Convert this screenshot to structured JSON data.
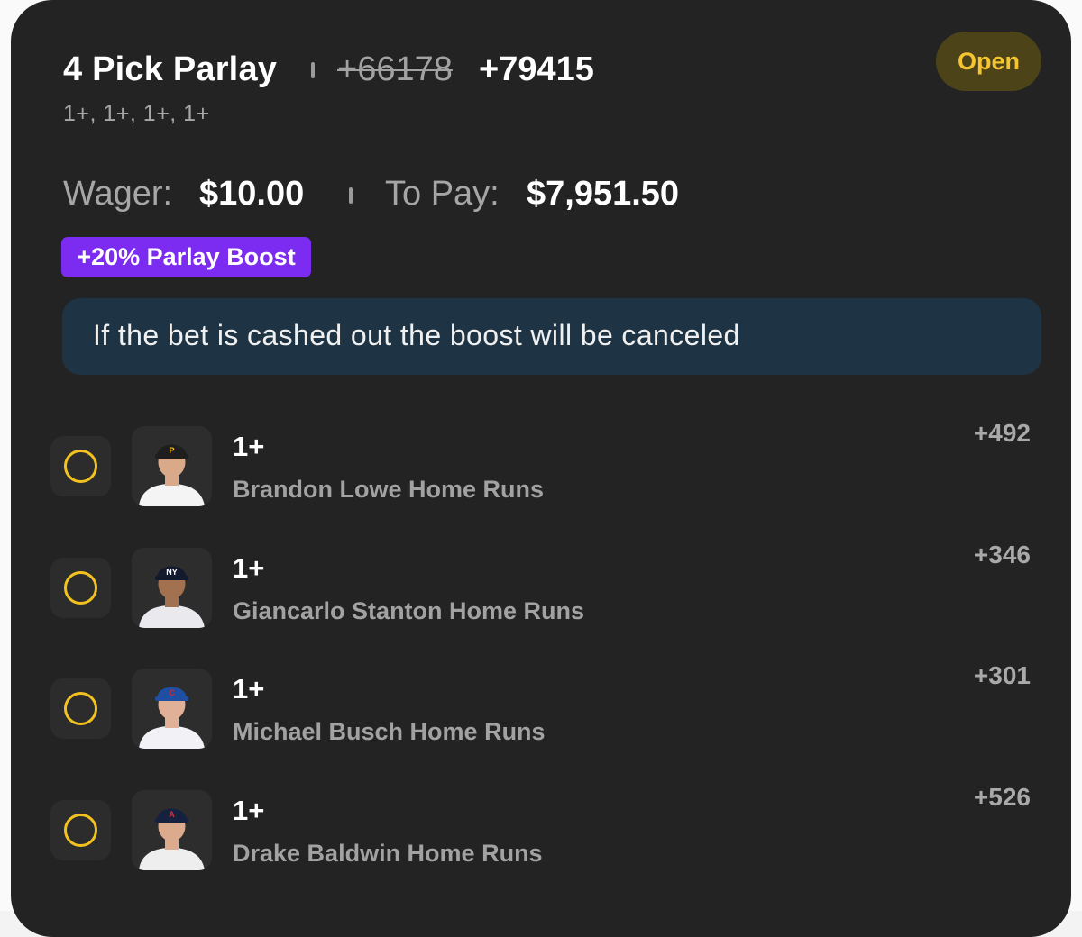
{
  "bet": {
    "title": "4 Pick Parlay",
    "original_odds": "+66178",
    "boosted_odds": "+79415",
    "lines_summary": "1+, 1+, 1+, 1+",
    "status": "Open",
    "wager_label": "Wager:",
    "wager_value": "$10.00",
    "to_pay_label": "To Pay:",
    "to_pay_value": "$7,951.50",
    "boost_label": "+20% Parlay Boost",
    "notice": "If the bet is cashed out the boost will be canceled"
  },
  "picks": [
    {
      "line": "1+",
      "market": "Brandon Lowe Home Runs",
      "odds": "+492",
      "team": "Pirates",
      "cap_color": "#1e1e1e",
      "cap_logo": "P",
      "logo_color": "#f7c023",
      "jersey_color": "#f4f4f4",
      "skin": "#d9a98a"
    },
    {
      "line": "1+",
      "market": "Giancarlo Stanton Home Runs",
      "odds": "+346",
      "team": "Yankees",
      "cap_color": "#141a2e",
      "cap_logo": "NY",
      "logo_color": "#ffffff",
      "jersey_color": "#e9e9ee",
      "skin": "#a2714f"
    },
    {
      "line": "1+",
      "market": "Michael Busch Home Runs",
      "odds": "+301",
      "team": "Cubs",
      "cap_color": "#1f4fa3",
      "cap_logo": "C",
      "logo_color": "#d7262d",
      "jersey_color": "#f2f2f6",
      "skin": "#e0b097"
    },
    {
      "line": "1+",
      "market": "Drake Baldwin Home Runs",
      "odds": "+526",
      "team": "Braves",
      "cap_color": "#16213f",
      "cap_logo": "A",
      "logo_color": "#d6303c",
      "jersey_color": "#eeeeee",
      "skin": "#dcab8d"
    }
  ],
  "colors": {
    "card_bg": "#232323",
    "status_text": "#f4c431",
    "status_bg": "#4d4319",
    "boost_bg": "#7b2cf0",
    "notice_bg": "#1e3444",
    "check_ring": "#f3c21f"
  },
  "icons": {
    "pick_status": "open-circle-icon",
    "player": "player-headshot-icon"
  }
}
